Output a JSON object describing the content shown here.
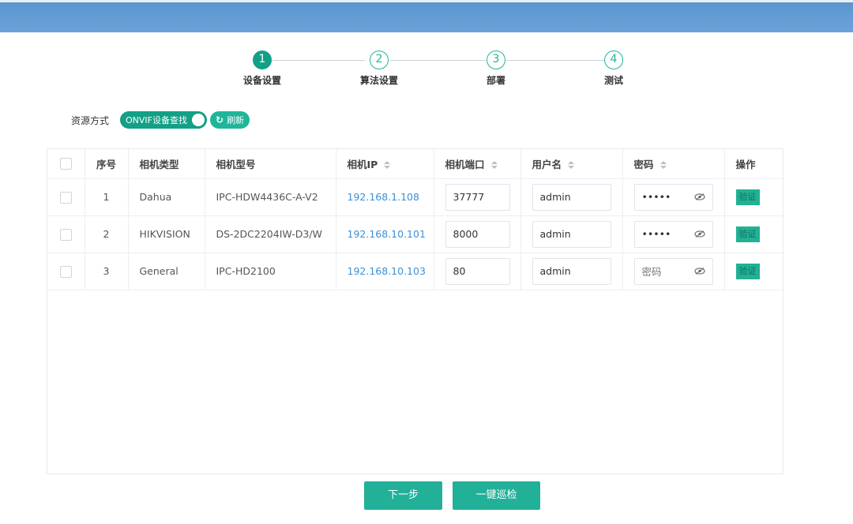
{
  "steps": [
    {
      "num": "1",
      "label": "设备设置",
      "active": true
    },
    {
      "num": "2",
      "label": "算法设置",
      "active": false
    },
    {
      "num": "3",
      "label": "部署",
      "active": false
    },
    {
      "num": "4",
      "label": "测试",
      "active": false
    }
  ],
  "source": {
    "label": "资源方式",
    "toggle_label": "ONVIF设备查找",
    "refresh_label": "刷新"
  },
  "table": {
    "headers": {
      "index": "序号",
      "camera_type": "相机类型",
      "camera_model": "相机型号",
      "camera_ip": "相机IP",
      "camera_port": "相机端口",
      "username": "用户名",
      "password": "密码",
      "action": "操作"
    },
    "rows": [
      {
        "index": "1",
        "type": "Dahua",
        "model": "IPC-HDW4436C-A-V2",
        "ip": "192.168.1.108",
        "port": "37777",
        "username": "admin",
        "password": "•••••",
        "password_placeholder": "",
        "action": "验证"
      },
      {
        "index": "2",
        "type": "HIKVISION",
        "model": "DS-2DC2204IW-D3/W",
        "ip": "192.168.10.101",
        "port": "8000",
        "username": "admin",
        "password": "•••••",
        "password_placeholder": "",
        "action": "验证"
      },
      {
        "index": "3",
        "type": "General",
        "model": "IPC-HD2100",
        "ip": "192.168.10.103",
        "port": "80",
        "username": "admin",
        "password": "",
        "password_placeholder": "密码",
        "action": "验证"
      }
    ]
  },
  "footer": {
    "next_label": "下一步",
    "patrol_label": "一键巡检"
  },
  "colors": {
    "accent": "#12a086",
    "topbar": "#6aa3d8",
    "link": "#3d8fd6"
  }
}
